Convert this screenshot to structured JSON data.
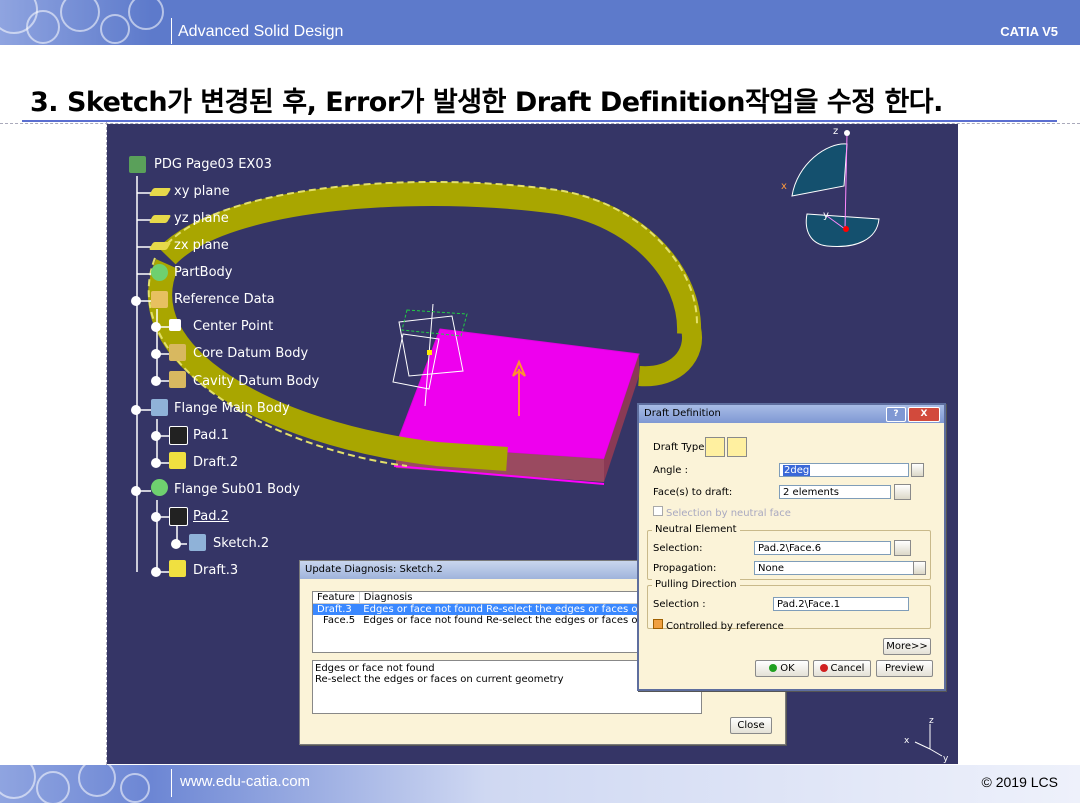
{
  "slide": {
    "header_title": "Advanced Solid Design",
    "header_right": "CATIA V5",
    "heading": "3. Sketch가 변경된 후, Error가 발생한 Draft Definition작업을 수정 한다.",
    "footer_left": "www.edu-catia.com",
    "footer_right": "© 2019 LCS"
  },
  "tree": {
    "root": "PDG Page03 EX03",
    "items": [
      {
        "label": "xy plane"
      },
      {
        "label": "yz plane"
      },
      {
        "label": "zx plane"
      },
      {
        "label": "PartBody"
      },
      {
        "label": "Reference Data"
      },
      {
        "label": "Center Point"
      },
      {
        "label": "Core Datum Body"
      },
      {
        "label": "Cavity Datum Body"
      },
      {
        "label": "Flange Main Body"
      },
      {
        "label": "Pad.1"
      },
      {
        "label": "Draft.2"
      },
      {
        "label": "Flange Sub01 Body"
      },
      {
        "label": "Pad.2"
      },
      {
        "label": "Sketch.2"
      },
      {
        "label": "Draft.3"
      }
    ]
  },
  "compass": {
    "z": "z",
    "x": "x",
    "y": "y"
  },
  "axis_triad": {
    "z": "z",
    "x": "x",
    "y": "y"
  },
  "update_diagnosis": {
    "title": "Update Diagnosis: Sketch.2",
    "columns": [
      "Feature",
      "Diagnosis"
    ],
    "rows": [
      {
        "feature": "Draft.3",
        "diagnosis": "Edges or face not found Re-select the edges or faces on",
        "selected": true
      },
      {
        "feature": "Face.5",
        "diagnosis": "Edges or face not found Re-select the edges or faces on",
        "selected": false
      }
    ],
    "detail_line1": "Edges or face not found",
    "detail_line2": "Re-select the edges or faces on current geometry",
    "close_label": "Close"
  },
  "draft_definition": {
    "title": "Draft Definition",
    "help_label": "?",
    "close_x": "X",
    "draft_type_label": "Draft Type:",
    "angle_label": "Angle :",
    "angle_value": "2deg",
    "faces_label": "Face(s) to draft:",
    "faces_value": "2 elements",
    "selection_neutral_label": "Selection by neutral face",
    "neutral_group": "Neutral Element",
    "neutral_selection_label": "Selection:",
    "neutral_selection_value": "Pad.2\\Face.6",
    "propagation_label": "Propagation:",
    "propagation_value": "None",
    "pulling_group": "Pulling Direction",
    "pulling_selection_label": "Selection :",
    "pulling_selection_value": "Pad.2\\Face.1",
    "controlled_label": "Controlled by reference",
    "more_label": "More>>",
    "ok_label": "OK",
    "cancel_label": "Cancel",
    "preview_label": "Preview"
  },
  "colors": {
    "viewport_bg": "#353566",
    "magenta": "#ee00ee",
    "flange": "#c4bf00",
    "band": "#5b78c9"
  }
}
